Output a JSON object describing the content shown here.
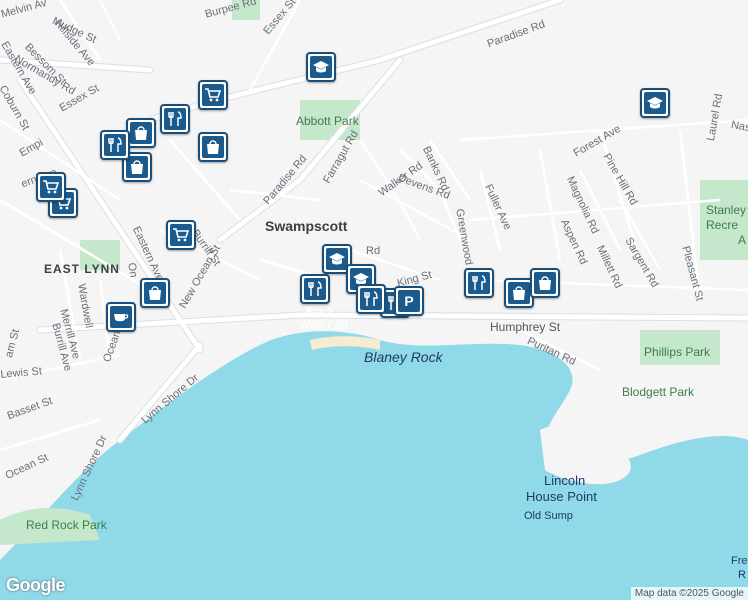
{
  "map": {
    "colors": {
      "land": "#f5f5f5",
      "water": "#8fd9e9",
      "park": "#c5e7cb",
      "road": "#ffffff",
      "road_outline": "#dcdfe3",
      "marker_fill": "#1a5a8c",
      "marker_border": "#1a4e7a"
    },
    "places": {
      "swampscott": "Swampscott",
      "east_lynn": "EAST LYNN"
    },
    "parks": {
      "abbott_park": "Abbott Park",
      "phillips_park": "Phillips Park",
      "blodgett_park": "Blodgett Park",
      "red_rock_park": "Red Rock Park",
      "stanley_recreation_line1": "Stanley",
      "stanley_recreation_line2": "Recre",
      "stanley_recreation_line3": "A"
    },
    "water_features": {
      "blaney_rock": "Blaney Rock",
      "black_wills_cliff_line1": "Black",
      "black_wills_cliff_line2": "Wills Cliff",
      "lincoln_house_point_line1": "Lincoln",
      "lincoln_house_point_line2": "House Point",
      "old_sump": "Old Sump",
      "fre_line1": "Fre",
      "fre_line2": "R"
    },
    "streets": {
      "paradise_rd_n": "Paradise Rd",
      "paradise_rd": "Paradise Rd",
      "essex_st": "Essex St",
      "essex_st_top": "Essex St",
      "burpee_rd": "Burpee Rd",
      "melvin_av": "Melvin Av",
      "hillside_ave": "Hillside Ave",
      "mudge_st": "Mudge St",
      "bessom_st": "Bessom St",
      "normandy_rd": "Normandy Rd",
      "eastern_ave_top": "Eastern Ave",
      "coburn_st": "Coburn St",
      "farragut_rd": "Farragut Rd",
      "walker_rd": "Walker Rd",
      "devens_rd": "Devens Rd",
      "banks_rd": "Banks Rd",
      "fuller_ave": "Fuller Ave",
      "greenwood_av": "Greenwood Av",
      "magnolia_rd": "Magnolia Rd",
      "aspen_rd": "Aspen Rd",
      "millett_rd": "Millett Rd",
      "pine_hill_rd": "Pine Hill Rd",
      "sargent_rd": "Sargent Rd",
      "forest_ave": "Forest Ave",
      "laurel_rd": "Laurel Rd",
      "nas": "Nas",
      "pleasant_st": "Pleasant St",
      "humphrey_st": "Humphrey St",
      "puritan_rd": "Puritan Rd",
      "king_st": "King St",
      "burrill_st": "Burrill St",
      "new_ocean_st": "New Ocean St",
      "eastern_ave": "Eastern Ave",
      "wardwell": "Wardwell",
      "merrill_ave": "Merrill Ave",
      "burrill_ave": "Burrill Ave",
      "ocean_st": "Ocean St",
      "lynn_shore_dr": "Lynn Shore Dr",
      "lewis_st": "Lewis St",
      "basset_st": "Basset St",
      "ocean_st_left": "Ocean St",
      "lynn_shore_dr_lower": "Lynn Shore Dr",
      "on": "On",
      "empi": "Empi",
      "ern_ave": "ern Ave",
      "am_st": "am St",
      "rd_partial": "Rd"
    },
    "markers": [
      {
        "icon": "school-icon",
        "label_name": "school"
      },
      {
        "icon": "school-icon",
        "label_name": "school"
      },
      {
        "icon": "school-icon",
        "label_name": "school"
      },
      {
        "icon": "school-icon",
        "label_name": "school"
      },
      {
        "icon": "shopping-cart-icon",
        "label_name": "grocery"
      },
      {
        "icon": "shopping-cart-icon",
        "label_name": "grocery"
      },
      {
        "icon": "shopping-cart-icon",
        "label_name": "grocery"
      },
      {
        "icon": "shopping-cart-icon",
        "label_name": "grocery"
      },
      {
        "icon": "shopping-bag-icon",
        "label_name": "store"
      },
      {
        "icon": "shopping-bag-icon",
        "label_name": "store"
      },
      {
        "icon": "shopping-bag-icon",
        "label_name": "store"
      },
      {
        "icon": "shopping-bag-icon",
        "label_name": "store"
      },
      {
        "icon": "shopping-bag-icon",
        "label_name": "store"
      },
      {
        "icon": "shopping-bag-icon",
        "label_name": "store"
      },
      {
        "icon": "restaurant-icon",
        "label_name": "restaurant"
      },
      {
        "icon": "restaurant-icon",
        "label_name": "restaurant"
      },
      {
        "icon": "restaurant-icon",
        "label_name": "restaurant"
      },
      {
        "icon": "restaurant-icon",
        "label_name": "restaurant"
      },
      {
        "icon": "restaurant-icon",
        "label_name": "restaurant"
      },
      {
        "icon": "restaurant-icon",
        "label_name": "restaurant"
      },
      {
        "icon": "coffee-icon",
        "label_name": "cafe"
      },
      {
        "icon": "parking-icon",
        "label_name": "parking"
      }
    ],
    "attribution": "Map data ©2025 Google",
    "logo": "Google"
  }
}
